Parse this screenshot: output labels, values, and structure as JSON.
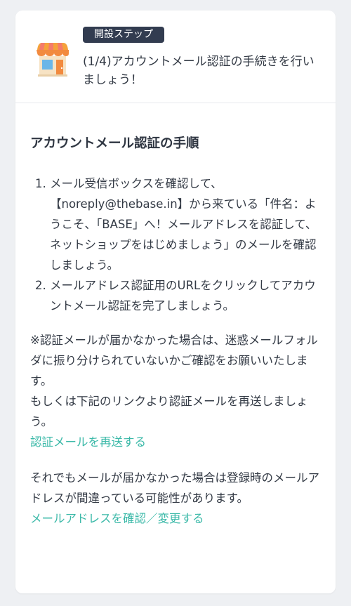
{
  "header": {
    "badge": "開設ステップ",
    "title": "(1/4)アカウントメール認証の手続きを行いましょう！",
    "icon": "shop-icon"
  },
  "section": {
    "title": "アカウントメール認証の手順",
    "steps": [
      "メール受信ボックスを確認して、【noreply@thebase.in】から来ている「件名：ようこそ、「BASE」へ！メールアドレスを認証して、ネットショップをはじめましょう」のメールを確認しましょう。",
      "メールアドレス認証用のURLをクリックしてアカウントメール認証を完了しましょう。"
    ],
    "note_line1": "※認証メールが届かなかった場合は、迷惑メールフォルダに振り分けられていないかご確認をお願いいたします。",
    "note_line2": "もしくは下記のリンクより認証メールを再送しましょう。",
    "resend_link": "認証メールを再送する",
    "note_line3": "それでもメールが届かなかった場合は登録時のメールアドレスが間違っている可能性があります。",
    "change_link": "メールアドレスを確認／変更する"
  },
  "colors": {
    "badge_bg": "#323c50",
    "link": "#3bb9a8",
    "text": "#333a45"
  }
}
